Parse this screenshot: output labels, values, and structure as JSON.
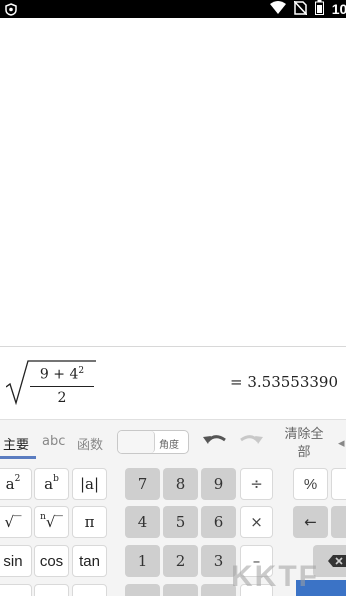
{
  "status_bar": {
    "time": "10:",
    "icons": [
      "app-shield-icon",
      "wifi-icon",
      "no-sim-icon",
      "battery-icon"
    ]
  },
  "expression": {
    "numerator_base": "9 + 4",
    "numerator_exponent": "2",
    "denominator": "2",
    "result": "= 3.53553390"
  },
  "keyboard": {
    "tabs": [
      "主要",
      "abc",
      "函数"
    ],
    "active_tab": 0,
    "angle_toggle_label": "角度",
    "clear_all": "清除全部",
    "clear_all_line1": "清除全",
    "clear_all_line2": "部",
    "function_keys": {
      "a_squared_base": "a",
      "a_squared_exp": "2",
      "a_power_base": "a",
      "a_power_exp": "b",
      "abs": "|a|",
      "sqrt": "√‾",
      "nth_root_index": "n",
      "nth_root_symbol": "√‾",
      "pi": "π",
      "sin": "sin",
      "cos": "cos",
      "tan": "tan"
    },
    "number_keys": {
      "row1": [
        "7",
        "8",
        "9"
      ],
      "row2": [
        "4",
        "5",
        "6"
      ],
      "row3": [
        "1",
        "2",
        "3"
      ]
    },
    "operators": {
      "divide": "÷",
      "multiply": "×",
      "minus": "–",
      "percent": "%",
      "left_arrow": "←"
    },
    "accent_color": "#5a7cc0"
  },
  "watermark": "KKTF"
}
